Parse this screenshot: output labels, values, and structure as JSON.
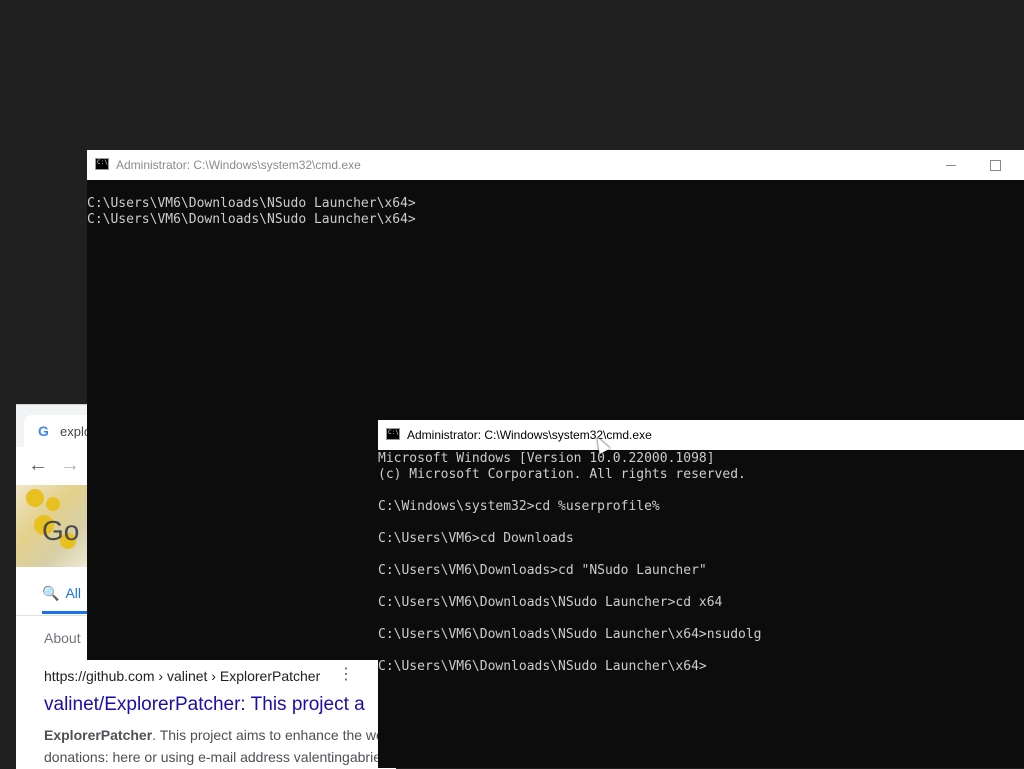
{
  "browser": {
    "tab_favicon": "G",
    "tab_title": "explo",
    "back_icon": "arrow-left-icon",
    "forward_icon": "arrow-right-icon",
    "doodle_text": "Go",
    "filter_all": "All",
    "about": "About",
    "result": {
      "cite": "https://github.com › valinet › ExplorerPatcher",
      "title": "valinet/ExplorerPatcher: This project a",
      "snippet_bold": "ExplorerPatcher",
      "snippet_line1_rest": ". This project aims to enhance the wo",
      "snippet_line2": "donations: here or using e-mail address valentingabrie"
    }
  },
  "cmd_back": {
    "title": "Administrator: C:\\Windows\\system32\\cmd.exe",
    "lines": [
      "C:\\Users\\VM6\\Downloads\\NSudo Launcher\\x64>",
      "C:\\Users\\VM6\\Downloads\\NSudo Launcher\\x64>"
    ]
  },
  "cmd_front": {
    "title": "Administrator: C:\\Windows\\system32\\cmd.exe",
    "lines": [
      "Microsoft Windows [Version 10.0.22000.1098]",
      "(c) Microsoft Corporation. All rights reserved.",
      "",
      "C:\\Windows\\system32>cd %userprofile%",
      "",
      "C:\\Users\\VM6>cd Downloads",
      "",
      "C:\\Users\\VM6\\Downloads>cd \"NSudo Launcher\"",
      "",
      "C:\\Users\\VM6\\Downloads\\NSudo Launcher>cd x64",
      "",
      "C:\\Users\\VM6\\Downloads\\NSudo Launcher\\x64>nsudolg",
      "",
      "C:\\Users\\VM6\\Downloads\\NSudo Launcher\\x64>"
    ]
  },
  "colors": {
    "desktop": "#202020",
    "console_bg": "#0c0c0c",
    "console_text": "#cccccc",
    "link": "#1a0dab",
    "accent": "#1a73e8"
  }
}
